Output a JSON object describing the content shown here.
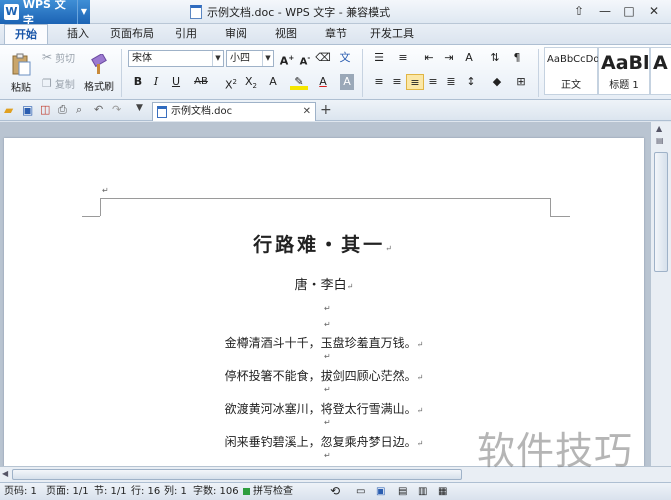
{
  "app": {
    "name": "WPS 文字",
    "window_title": "示例文档.doc - WPS 文字 - 兼容模式"
  },
  "tabs": [
    "开始",
    "插入",
    "页面布局",
    "引用",
    "审阅",
    "视图",
    "章节",
    "开发工具"
  ],
  "ribbon": {
    "paste": "粘贴",
    "cut": "剪切",
    "copy": "复制",
    "format_painter": "格式刷",
    "font_name": "宋体",
    "font_size": "小四",
    "styles": [
      {
        "preview": "AaBbCcDd",
        "name": "正文"
      },
      {
        "preview": "AaBl",
        "name": "标题 1"
      },
      {
        "preview": "A",
        "name": ""
      }
    ]
  },
  "document_tab": {
    "name": "示例文档.doc"
  },
  "document": {
    "title": "行路难・其一",
    "author": "唐・李白",
    "lines": [
      "金樽清酒斗十千，玉盘珍羞直万钱。",
      "停杯投箸不能食，拔剑四顾心茫然。",
      "欲渡黄河冰塞川，将登太行雪满山。",
      "闲来垂钓碧溪上，忽复乘舟梦日边。"
    ],
    "para_mark": "↵"
  },
  "status": {
    "page_num": "页码: 1",
    "pages": "页面: 1/1",
    "section": "节: 1/1",
    "row": "行: 16",
    "col": "列: 1",
    "words": "字数: 106",
    "spell": "拼写检查"
  },
  "watermark": "软件技巧",
  "colors": {
    "accent": "#1c63b4",
    "status_ok": "#2e9e3e"
  }
}
